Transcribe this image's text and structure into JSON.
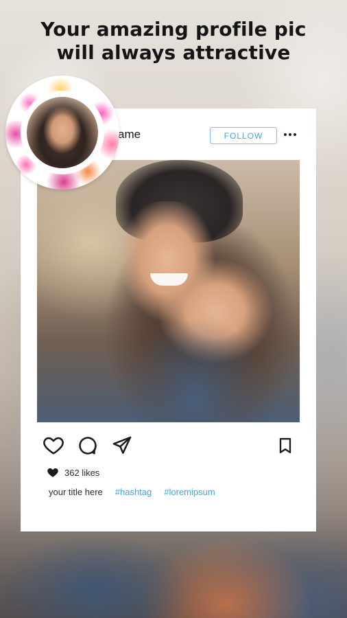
{
  "headline": {
    "line1": "Your amazing profile pic",
    "line2": "will always attractive"
  },
  "post": {
    "username_visible": "ame",
    "follow_label": "FOLLOW",
    "likes_text": "362 likes",
    "caption_title": "your title here",
    "hashtags": [
      "#hashtag",
      "#loremipsum"
    ]
  },
  "colors": {
    "follow_accent": "#4aa3d2",
    "hashtag": "#4aa3d2",
    "text_primary": "#151515"
  },
  "icons": {
    "more": "more-horizontal-icon",
    "like": "heart-outline-icon",
    "comment": "comment-bubble-icon",
    "share": "paper-plane-icon",
    "save": "bookmark-icon",
    "likes_badge": "heart-filled-icon"
  }
}
